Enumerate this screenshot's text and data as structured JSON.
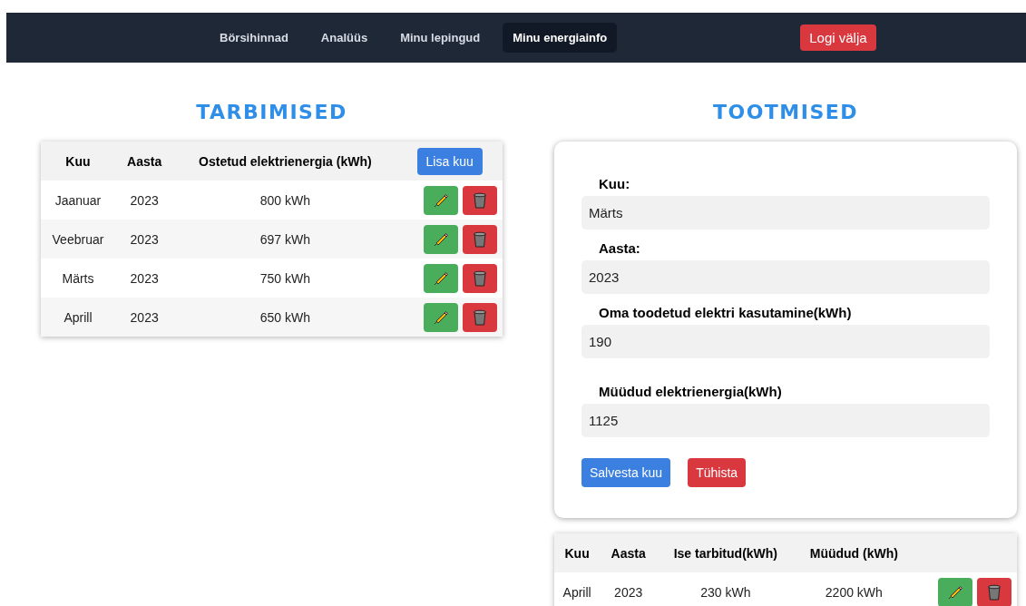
{
  "nav": {
    "items": [
      {
        "label": "Börsihinnad",
        "selected": false
      },
      {
        "label": "Analüüs",
        "selected": false
      },
      {
        "label": "Minu lepingud",
        "selected": false
      },
      {
        "label": "Minu energiainfo",
        "selected": true
      }
    ],
    "logout": "Logi välja"
  },
  "consumption": {
    "title": "TARBIMISED",
    "columns": [
      "Kuu",
      "Aasta",
      "Ostetud elektrienergia (kWh)"
    ],
    "add_button": "Lisa kuu",
    "rows": [
      [
        "Jaanuar",
        "2023",
        "800 kWh"
      ],
      [
        "Veebruar",
        "2023",
        "697 kWh"
      ],
      [
        "Märts",
        "2023",
        "750 kWh"
      ],
      [
        "Aprill",
        "2023",
        "650 kWh"
      ]
    ]
  },
  "production": {
    "title": "TOOTMISED",
    "form": {
      "fields": [
        {
          "label": "Kuu:",
          "value": "Märts"
        },
        {
          "label": "Aasta:",
          "value": "2023"
        },
        {
          "label": "Oma toodetud elektri kasutamine(kWh)",
          "value": "190"
        },
        {
          "label": "Müüdud elektrienergia(kWh)",
          "value": "1125"
        }
      ],
      "save": "Salvesta kuu",
      "cancel": "Tühista"
    },
    "columns": [
      "Kuu",
      "Aasta",
      "Ise tarbitud(kWh)",
      "Müüdud (kWh)"
    ],
    "rows": [
      [
        "Aprill",
        "2023",
        "230 kWh",
        "2200 kWh"
      ]
    ]
  }
}
